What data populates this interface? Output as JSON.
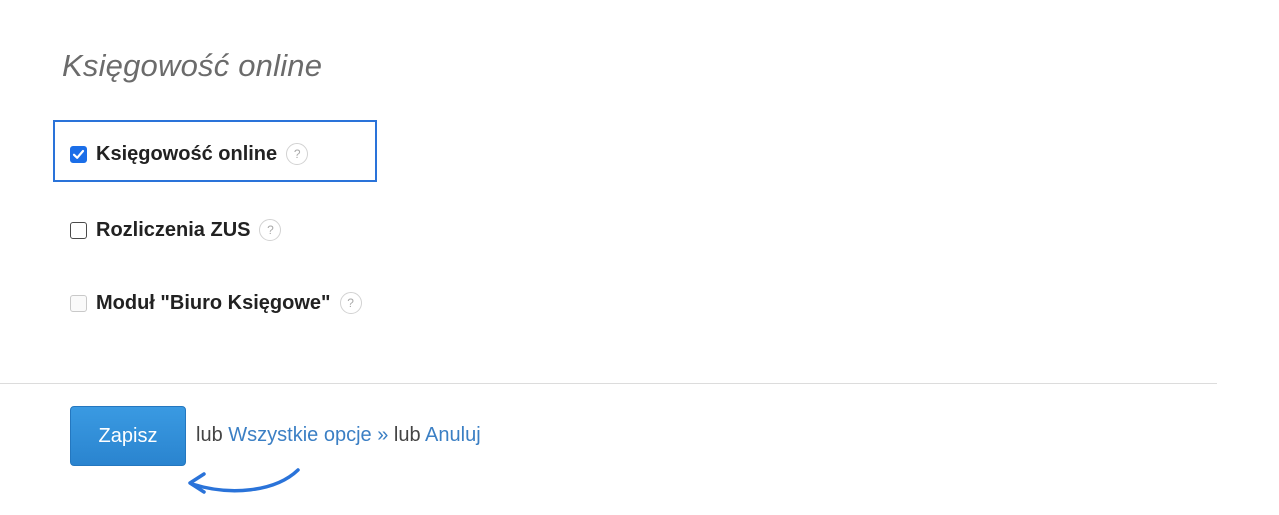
{
  "section": {
    "title": "Księgowość online"
  },
  "options": [
    {
      "label": "Księgowość online",
      "checked": true,
      "disabled": false,
      "help": "?"
    },
    {
      "label": "Rozliczenia ZUS",
      "checked": false,
      "disabled": false,
      "help": "?"
    },
    {
      "label": "Moduł \"Biuro Księgowe\"",
      "checked": false,
      "disabled": true,
      "help": "?"
    }
  ],
  "actions": {
    "save_label": "Zapisz",
    "or_1": "lub",
    "all_options_link": "Wszystkie opcje »",
    "or_2": "lub",
    "cancel_link": "Anuluj"
  },
  "colors": {
    "accent": "#2a84cf",
    "highlight": "#2a73d9",
    "link": "#3b7fc4"
  },
  "icons": {
    "help": "question-circle-icon",
    "annotation": "curved-arrow-icon"
  }
}
